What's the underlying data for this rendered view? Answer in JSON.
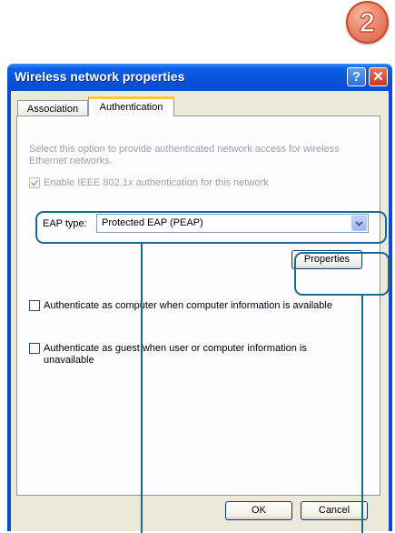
{
  "step": {
    "number": "2"
  },
  "window": {
    "title": "Wireless network properties",
    "help_glyph": "?",
    "close_glyph": "✕"
  },
  "tabs": [
    {
      "label": "Association",
      "active": false
    },
    {
      "label": "Authentication",
      "active": true
    }
  ],
  "auth": {
    "description": "Select this option to provide authenticated network access for wireless Ethernet networks.",
    "enable_8021x": {
      "label": "Enable IEEE 802.1x authentication for this network",
      "checked": true,
      "disabled": true
    },
    "eap_type": {
      "label": "EAP type:",
      "value": "Protected EAP (PEAP)"
    },
    "properties_button": "Properties",
    "auth_as_computer": {
      "label": "Authenticate as computer when computer information is available",
      "checked": false
    },
    "auth_as_guest": {
      "label": "Authenticate as guest when user or computer information is unavailable",
      "checked": false
    }
  },
  "buttons": {
    "ok": "OK",
    "cancel": "Cancel"
  },
  "colors": {
    "title_bar": "#0a4bd6",
    "annotation": "#1b6a8f",
    "badge": "#e0694b",
    "active_tab_accent": "#ffc83c"
  }
}
